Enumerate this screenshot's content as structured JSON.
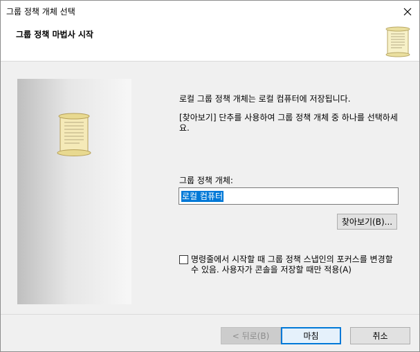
{
  "window": {
    "title": "그룹 정책 개체 선택"
  },
  "header": {
    "title": "그룹 정책 마법사 시작"
  },
  "main": {
    "desc1": "로컬 그룹 정책 개체는 로컬 컴퓨터에 저장됩니다.",
    "desc2": "[찾아보기] 단추를 사용하여 그룹 정책 개체 중 하나를 선택하세요.",
    "gpo_label": "그룹 정책 개체:",
    "gpo_value": "로컬 컴퓨터",
    "browse_label": "찾아보기(B)...",
    "checkbox_label": "명령줄에서 시작할 때 그룹 정책 스냅인의 포커스를 변경할 수 있음. 사용자가 콘솔을 저장할 때만 적용(A)",
    "checkbox_checked": false
  },
  "footer": {
    "back": "< 뒤로(B)",
    "finish": "마침",
    "cancel": "취소"
  },
  "icons": {
    "close": "close-icon",
    "scroll": "scroll-icon"
  }
}
